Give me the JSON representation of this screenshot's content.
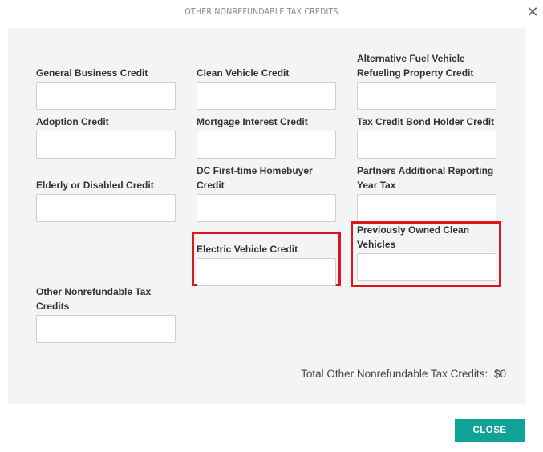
{
  "modal": {
    "title": "OTHER NONREFUNDABLE TAX CREDITS",
    "close_icon": "close-x-icon"
  },
  "fields": [
    {
      "id": "general-business-credit",
      "label": "General Business Credit",
      "value": "",
      "highlighted": false
    },
    {
      "id": "clean-vehicle-credit",
      "label": "Clean Vehicle Credit",
      "value": "",
      "highlighted": false
    },
    {
      "id": "alternative-fuel-vehicle-refueling-property-credit",
      "label": "Alternative Fuel Vehicle Refueling Property Credit",
      "value": "",
      "highlighted": false
    },
    {
      "id": "adoption-credit",
      "label": "Adoption Credit",
      "value": "",
      "highlighted": false
    },
    {
      "id": "mortgage-interest-credit",
      "label": "Mortgage Interest Credit",
      "value": "",
      "highlighted": false
    },
    {
      "id": "tax-credit-bond-holder-credit",
      "label": "Tax Credit Bond Holder Credit",
      "value": "",
      "highlighted": false
    },
    {
      "id": "elderly-or-disabled-credit",
      "label": "Elderly or Disabled Credit",
      "value": "",
      "highlighted": false
    },
    {
      "id": "dc-first-time-homebuyer-credit",
      "label": "DC First-time Homebuyer Credit",
      "value": "",
      "highlighted": false
    },
    {
      "id": "partners-additional-reporting-year-tax",
      "label": "Partners Additional Reporting Year Tax",
      "value": "",
      "highlighted": false
    },
    {
      "id": "electric-vehicle-credit",
      "label": "Electric Vehicle Credit",
      "value": "",
      "highlighted": true
    },
    {
      "id": "previously-owned-clean-vehicles",
      "label": "Previously Owned Clean Vehicles",
      "value": "",
      "highlighted": true
    },
    {
      "id": "other-nonrefundable-tax-credits",
      "label": "Other Nonrefundable Tax Credits",
      "value": "",
      "highlighted": false
    }
  ],
  "total": {
    "label": "Total Other Nonrefundable Tax Credits:",
    "value": "$0"
  },
  "footer": {
    "close_label": "CLOSE"
  },
  "colors": {
    "accent": "#0ea396",
    "highlight": "#e0141b",
    "panel_bg": "#f3f4f6"
  }
}
